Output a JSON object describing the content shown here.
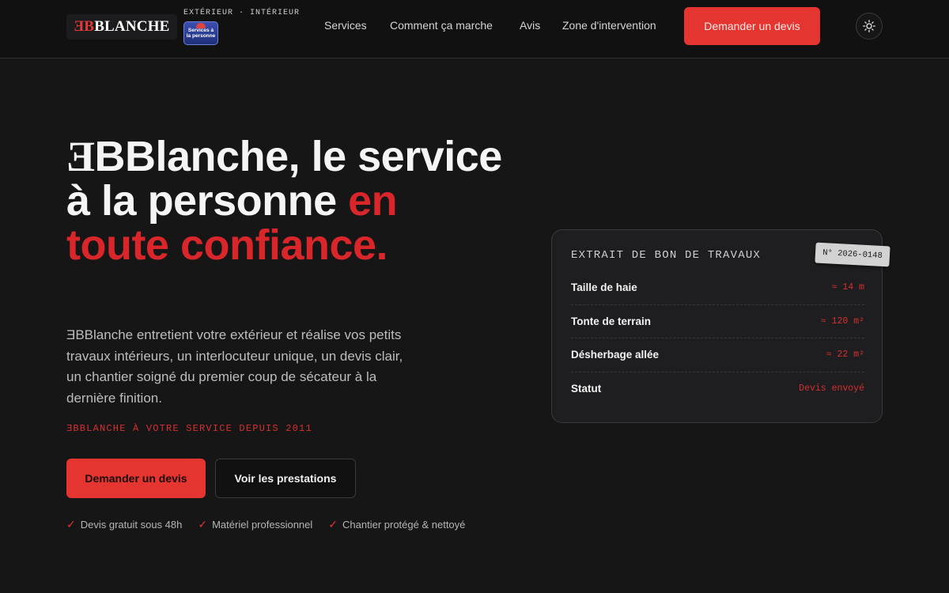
{
  "header": {
    "logo_mark": "ƎB",
    "logo_text": "BLANCHE",
    "tagline": "EXTÉRIEUR · INTÉRIEUR",
    "badge_line1": "Services à",
    "badge_line2": "la personne",
    "nav": [
      {
        "label": "Services"
      },
      {
        "label": "Comment ça marche"
      },
      {
        "label": "Avis"
      },
      {
        "label": "Zone d'intervention"
      }
    ],
    "cta_label": "Demander un devis",
    "theme_icon": "sun-icon"
  },
  "hero": {
    "title_mark": "Ǝ",
    "title_part1": "BBlanche, le service à la personne ",
    "title_accent": "en toute confiance.",
    "description": "ƎBBlanche entretient votre extérieur et réalise vos petits travaux intérieurs, un interlocuteur unique, un devis clair, un chantier soigné du premier coup de sécateur à la dernière finition.",
    "since": "ƎBBLANCHE À VOTRE SERVICE DEPUIS 2011",
    "primary_cta": "Demander un devis",
    "secondary_cta": "Voir les prestations",
    "checks": [
      {
        "label": "Devis gratuit sous 48h"
      },
      {
        "label": "Matériel professionnel"
      },
      {
        "label": "Chantier protégé & nettoyé"
      }
    ]
  },
  "card": {
    "title": "EXTRAIT DE BON DE TRAVAUX",
    "tag": "N° 2026-0148",
    "rows": [
      {
        "label": "Taille de haie",
        "value": "≈ 14 m"
      },
      {
        "label": "Tonte de terrain",
        "value": "≈ 120 m²"
      },
      {
        "label": "Désherbage allée",
        "value": "≈ 22 m²"
      },
      {
        "label": "Statut",
        "value": "Devis envoyé"
      }
    ]
  },
  "colors": {
    "accent": "#e53530",
    "background": "#161617",
    "header": "#111112"
  }
}
